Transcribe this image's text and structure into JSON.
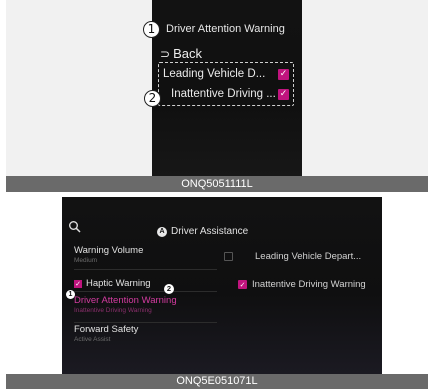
{
  "top_panel": {
    "callout_1": "1",
    "callout_2": "2",
    "title": "Driver Attention Warning",
    "back_icon": "back-arrow-icon",
    "back_label": "Back",
    "options": [
      {
        "label": "Leading Vehicle D...",
        "checked": true
      },
      {
        "label": "Inattentive Driving ...",
        "checked": true
      }
    ],
    "caption": "ONQ5051111L"
  },
  "bottom_panel": {
    "badge_a": "A",
    "title": "Driver Assistance",
    "search_icon": "search-icon",
    "left_items": [
      {
        "label": "Warning Volume",
        "sub": "Medium"
      },
      {
        "label": "Haptic Warning",
        "checked": true
      },
      {
        "label": "Driver Attention Warning",
        "sub": "Inattentive Driving Warning",
        "selected": true
      },
      {
        "label": "Forward Safety",
        "sub": "Active Assist"
      }
    ],
    "right_items": [
      {
        "label": "Leading Vehicle Depart...",
        "checked": false
      },
      {
        "label": "Inattentive Driving Warning",
        "checked": true
      }
    ],
    "badge_1": "1",
    "badge_2": "2",
    "caption": "ONQ5E051071L"
  },
  "colors": {
    "accent": "#c0147e",
    "screen_bg": "#121212",
    "caption_bg": "#6a6a6a"
  }
}
